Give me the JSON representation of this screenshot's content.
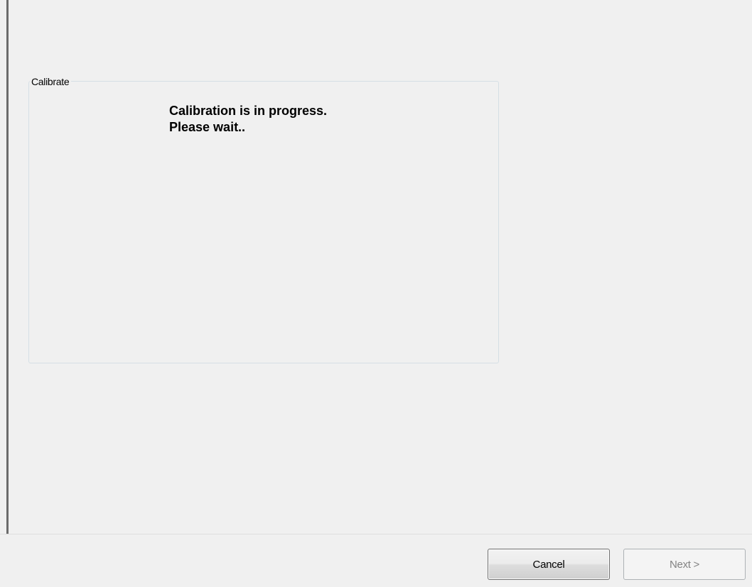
{
  "calibrate_group": {
    "legend": "Calibrate",
    "message_line1": "Calibration is in progress.",
    "message_line2": "Please wait.."
  },
  "footer": {
    "cancel_label": "Cancel",
    "next_label": "Next >",
    "next_enabled": false
  }
}
